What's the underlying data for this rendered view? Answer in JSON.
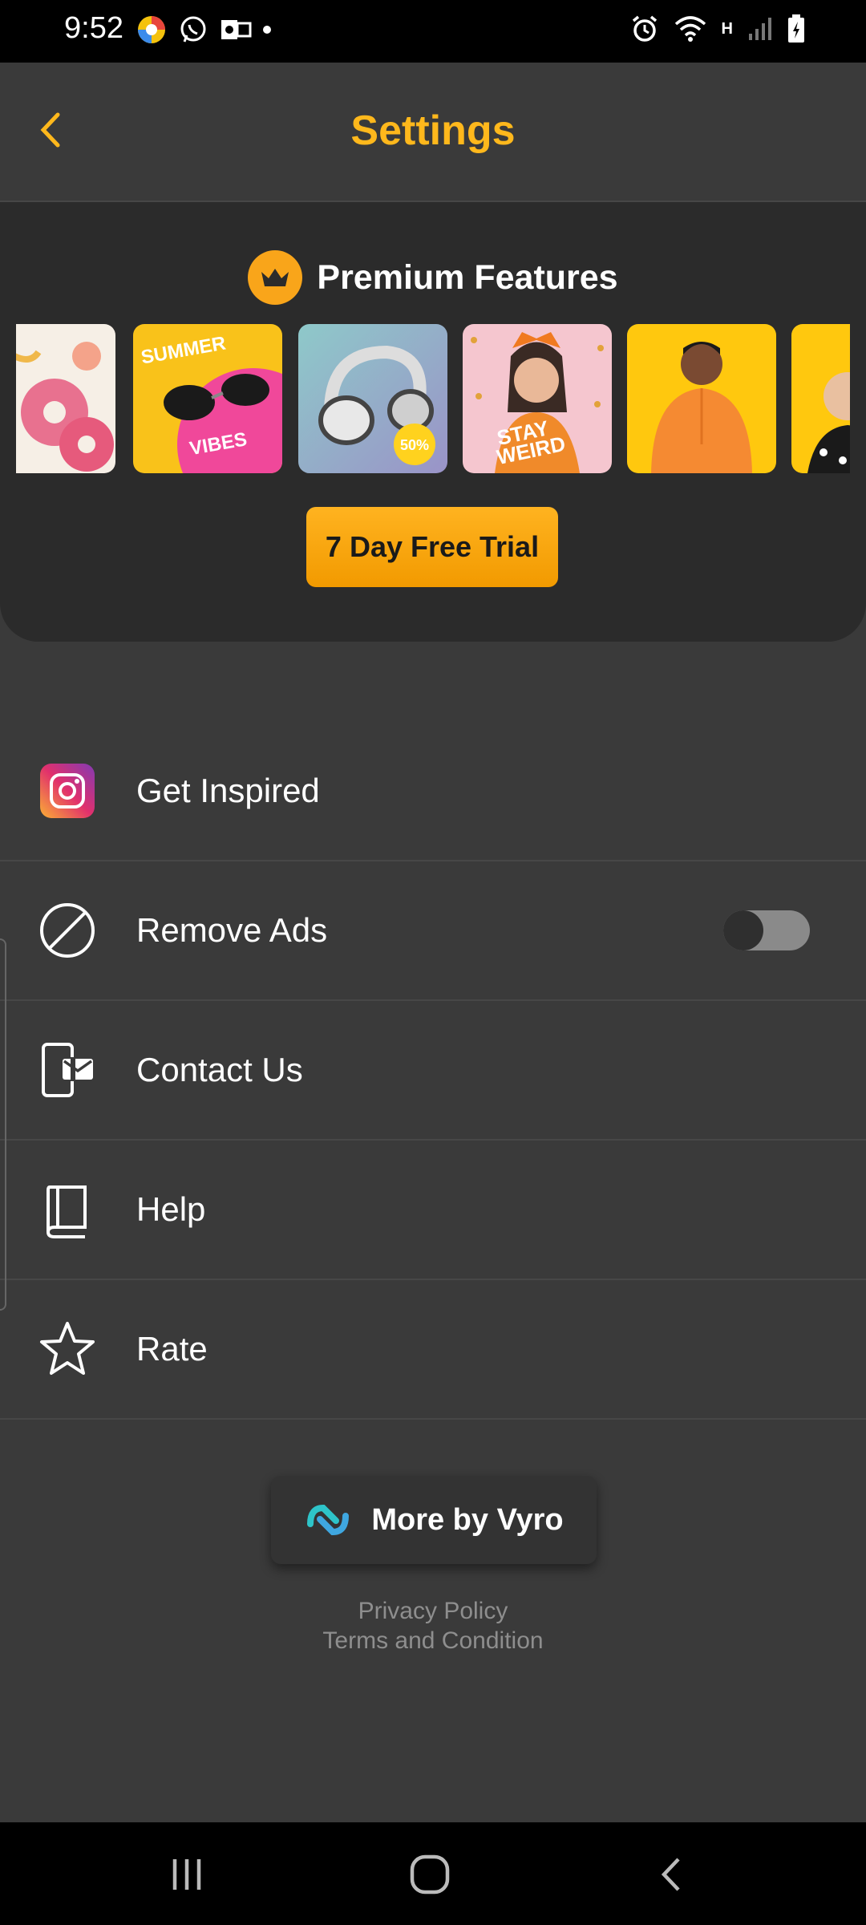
{
  "status_bar": {
    "time": "9:52",
    "network_label": "H"
  },
  "header": {
    "title": "Settings"
  },
  "premium": {
    "title": "Premium Features",
    "trial_label": "7 Day Free Trial",
    "thumbnails": [
      {
        "name": "donuts",
        "text": ""
      },
      {
        "name": "summer-vibes",
        "text_top": "SUMMER",
        "text_bottom": "VIBES"
      },
      {
        "name": "headphones",
        "badge": "50%"
      },
      {
        "name": "stay-weird",
        "text_top": "STAY",
        "text_bottom": "WEIRD"
      },
      {
        "name": "hoodie-man",
        "text": ""
      },
      {
        "name": "partial",
        "text": ""
      }
    ],
    "accent": "#ffb81c"
  },
  "menu": {
    "items": [
      {
        "label": "Get Inspired",
        "icon": "instagram-icon"
      },
      {
        "label": "Remove Ads",
        "icon": "block-icon",
        "toggle": false
      },
      {
        "label": "Contact Us",
        "icon": "contact-phone-icon"
      },
      {
        "label": "Help",
        "icon": "book-icon"
      },
      {
        "label": "Rate",
        "icon": "star-icon"
      }
    ]
  },
  "footer": {
    "more_label": "More by Vyro",
    "privacy": "Privacy Policy",
    "terms": "Terms and Condition"
  }
}
